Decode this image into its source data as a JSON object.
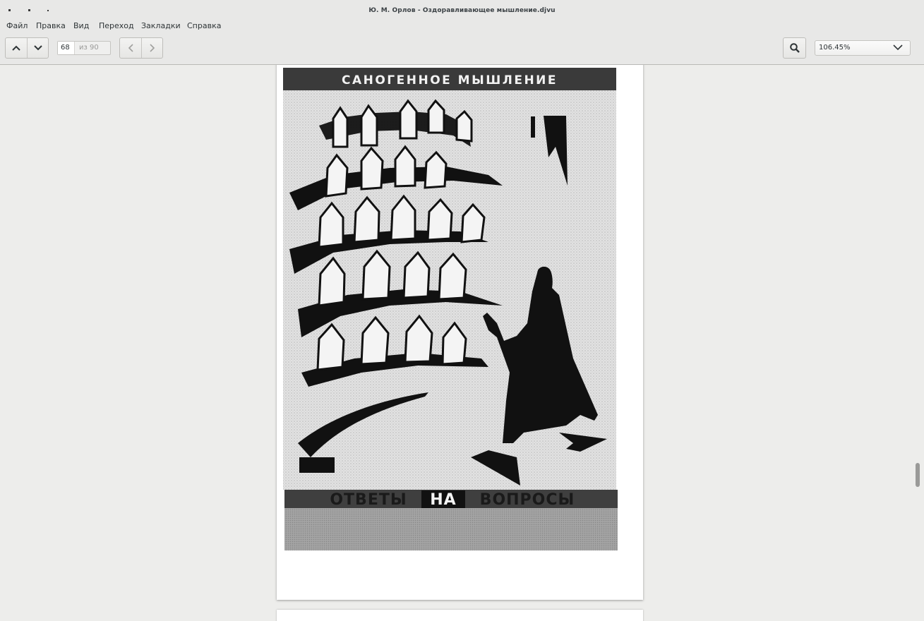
{
  "window": {
    "title": "Ю. М. Орлов - Оздоравливающее мышление.djvu"
  },
  "menu": {
    "items": [
      "Файл",
      "Правка",
      "Вид",
      "Переход",
      "Закладки",
      "Справка"
    ]
  },
  "toolbar": {
    "up_icon": "chevron-up-icon",
    "down_icon": "chevron-down-icon",
    "page_current": "68",
    "page_total": "из 90",
    "back_icon": "chevron-left-icon",
    "forward_icon": "chevron-right-icon",
    "search_icon": "search-icon",
    "zoom_value": "106.45%"
  },
  "document": {
    "cover_title": "САНОГЕННОЕ МЫШЛЕНИЕ",
    "cover_subtitle_part1": "ОТВЕТЫ",
    "cover_subtitle_part2": "НА",
    "cover_subtitle_part3": "ВОПРОСЫ"
  },
  "scrollbar": {
    "position": 0.74
  }
}
